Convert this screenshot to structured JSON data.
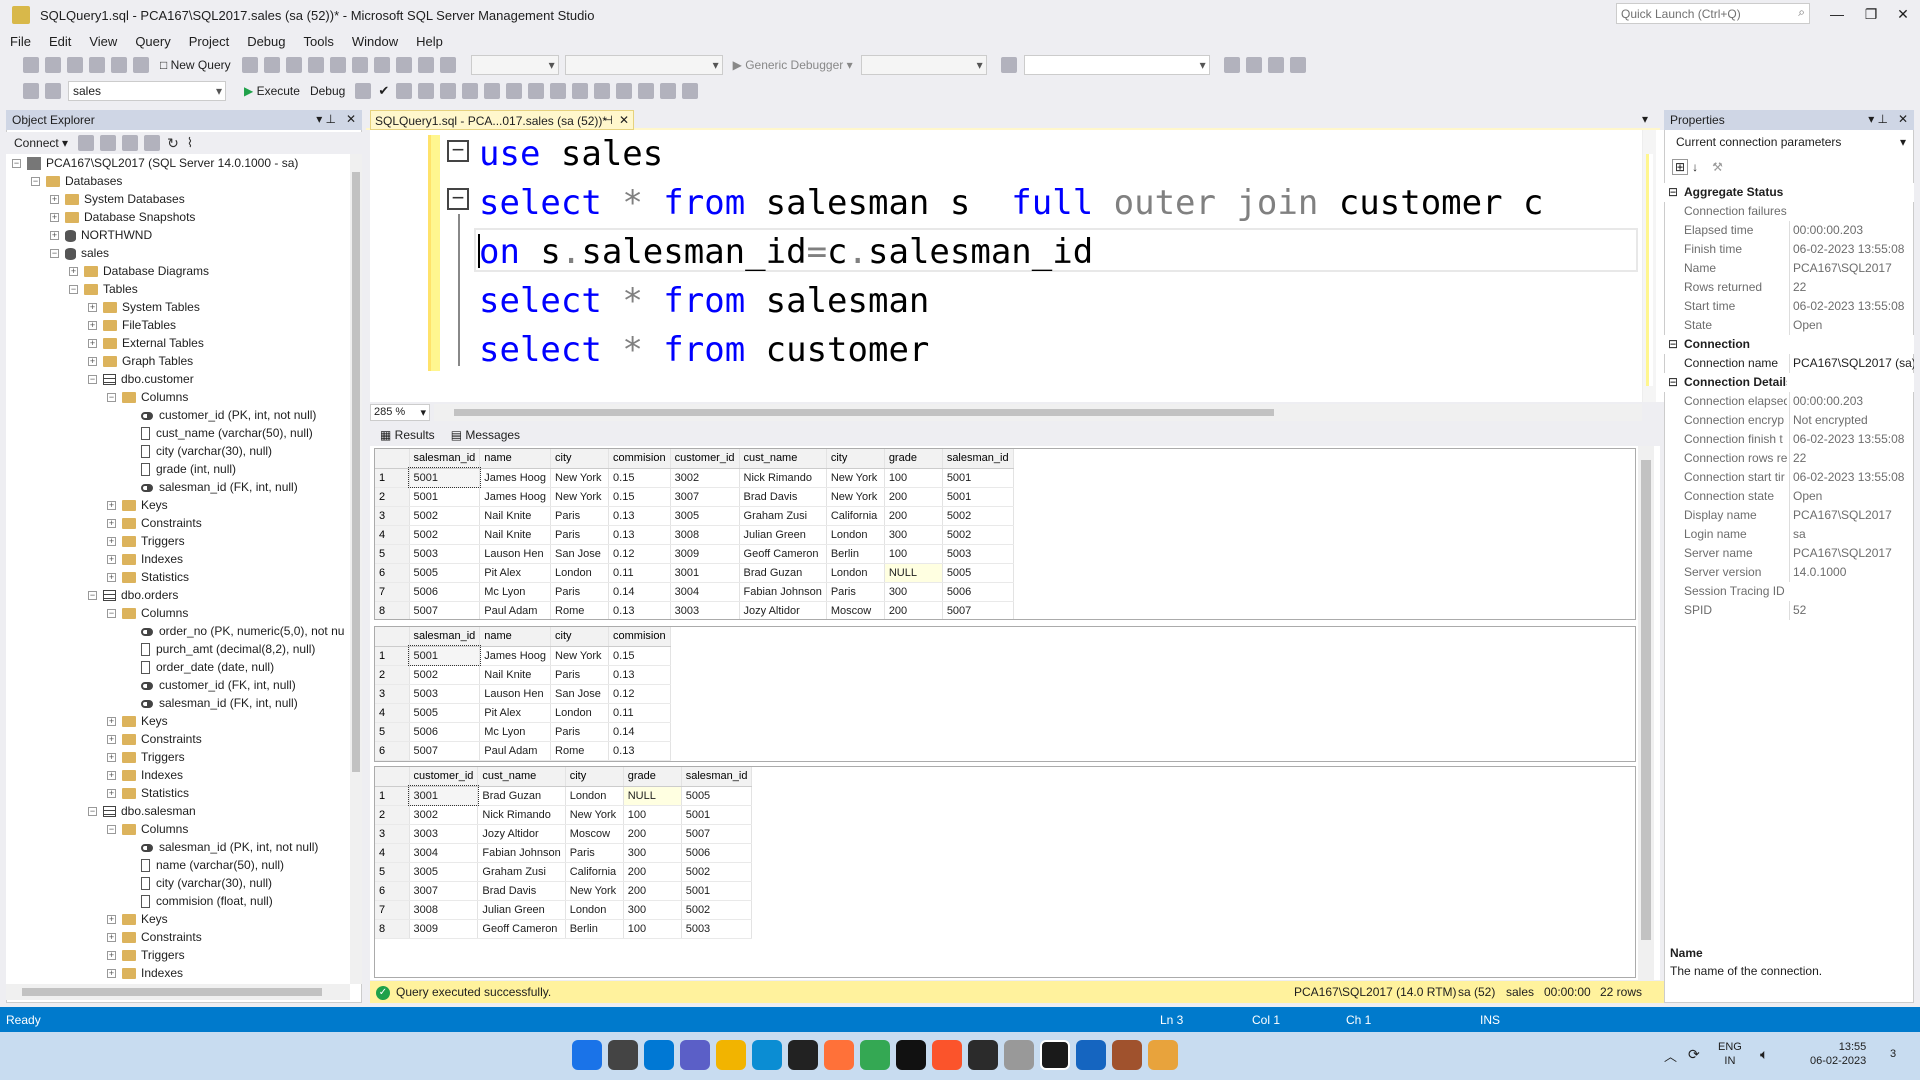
{
  "window": {
    "title": "SQLQuery1.sql - PCA167\\SQL2017.sales (sa (52))* - Microsoft SQL Server Management Studio",
    "quick_launch": "Quick Launch (Ctrl+Q)"
  },
  "menu": [
    "File",
    "Edit",
    "View",
    "Query",
    "Project",
    "Debug",
    "Tools",
    "Window",
    "Help"
  ],
  "toolbar": {
    "new_query": "New Query",
    "generic_debugger": "Generic Debugger",
    "database": "sales",
    "execute": "Execute",
    "debug": "Debug"
  },
  "object_explorer": {
    "title": "Object Explorer",
    "connect": "Connect",
    "tree": [
      {
        "label": "PCA167\\SQL2017 (SQL Server 14.0.1000 - sa)",
        "depth": 0,
        "icon": "server-icon",
        "toggle": "-"
      },
      {
        "label": "Databases",
        "depth": 1,
        "icon": "folder-icon",
        "toggle": "-"
      },
      {
        "label": "System Databases",
        "depth": 2,
        "icon": "folder-icon",
        "toggle": "+"
      },
      {
        "label": "Database Snapshots",
        "depth": 2,
        "icon": "folder-icon",
        "toggle": "+"
      },
      {
        "label": "NORTHWND",
        "depth": 2,
        "icon": "database-icon",
        "toggle": "+"
      },
      {
        "label": "sales",
        "depth": 2,
        "icon": "database-icon",
        "toggle": "-"
      },
      {
        "label": "Database Diagrams",
        "depth": 3,
        "icon": "folder-icon",
        "toggle": "+"
      },
      {
        "label": "Tables",
        "depth": 3,
        "icon": "folder-icon",
        "toggle": "-"
      },
      {
        "label": "System Tables",
        "depth": 4,
        "icon": "folder-icon",
        "toggle": "+"
      },
      {
        "label": "FileTables",
        "depth": 4,
        "icon": "folder-icon",
        "toggle": "+"
      },
      {
        "label": "External Tables",
        "depth": 4,
        "icon": "folder-icon",
        "toggle": "+"
      },
      {
        "label": "Graph Tables",
        "depth": 4,
        "icon": "folder-icon",
        "toggle": "+"
      },
      {
        "label": "dbo.customer",
        "depth": 4,
        "icon": "table-icon",
        "toggle": "-"
      },
      {
        "label": "Columns",
        "depth": 5,
        "icon": "folder-icon",
        "toggle": "-"
      },
      {
        "label": "customer_id (PK, int, not null)",
        "depth": 6,
        "icon": "key-icon",
        "toggle": ""
      },
      {
        "label": "cust_name (varchar(50), null)",
        "depth": 6,
        "icon": "column-icon",
        "toggle": ""
      },
      {
        "label": "city (varchar(30), null)",
        "depth": 6,
        "icon": "column-icon",
        "toggle": ""
      },
      {
        "label": "grade (int, null)",
        "depth": 6,
        "icon": "column-icon",
        "toggle": ""
      },
      {
        "label": "salesman_id (FK, int, null)",
        "depth": 6,
        "icon": "key-icon",
        "toggle": ""
      },
      {
        "label": "Keys",
        "depth": 5,
        "icon": "folder-icon",
        "toggle": "+"
      },
      {
        "label": "Constraints",
        "depth": 5,
        "icon": "folder-icon",
        "toggle": "+"
      },
      {
        "label": "Triggers",
        "depth": 5,
        "icon": "folder-icon",
        "toggle": "+"
      },
      {
        "label": "Indexes",
        "depth": 5,
        "icon": "folder-icon",
        "toggle": "+"
      },
      {
        "label": "Statistics",
        "depth": 5,
        "icon": "folder-icon",
        "toggle": "+"
      },
      {
        "label": "dbo.orders",
        "depth": 4,
        "icon": "table-icon",
        "toggle": "-"
      },
      {
        "label": "Columns",
        "depth": 5,
        "icon": "folder-icon",
        "toggle": "-"
      },
      {
        "label": "order_no (PK, numeric(5,0), not nu",
        "depth": 6,
        "icon": "key-icon",
        "toggle": ""
      },
      {
        "label": "purch_amt (decimal(8,2), null)",
        "depth": 6,
        "icon": "column-icon",
        "toggle": ""
      },
      {
        "label": "order_date (date, null)",
        "depth": 6,
        "icon": "column-icon",
        "toggle": ""
      },
      {
        "label": "customer_id (FK, int, null)",
        "depth": 6,
        "icon": "key-icon",
        "toggle": ""
      },
      {
        "label": "salesman_id (FK, int, null)",
        "depth": 6,
        "icon": "key-icon",
        "toggle": ""
      },
      {
        "label": "Keys",
        "depth": 5,
        "icon": "folder-icon",
        "toggle": "+"
      },
      {
        "label": "Constraints",
        "depth": 5,
        "icon": "folder-icon",
        "toggle": "+"
      },
      {
        "label": "Triggers",
        "depth": 5,
        "icon": "folder-icon",
        "toggle": "+"
      },
      {
        "label": "Indexes",
        "depth": 5,
        "icon": "folder-icon",
        "toggle": "+"
      },
      {
        "label": "Statistics",
        "depth": 5,
        "icon": "folder-icon",
        "toggle": "+"
      },
      {
        "label": "dbo.salesman",
        "depth": 4,
        "icon": "table-icon",
        "toggle": "-"
      },
      {
        "label": "Columns",
        "depth": 5,
        "icon": "folder-icon",
        "toggle": "-"
      },
      {
        "label": "salesman_id (PK, int, not null)",
        "depth": 6,
        "icon": "key-icon",
        "toggle": ""
      },
      {
        "label": "name (varchar(50), null)",
        "depth": 6,
        "icon": "column-icon",
        "toggle": ""
      },
      {
        "label": "city (varchar(30), null)",
        "depth": 6,
        "icon": "column-icon",
        "toggle": ""
      },
      {
        "label": "commision (float, null)",
        "depth": 6,
        "icon": "column-icon",
        "toggle": ""
      },
      {
        "label": "Keys",
        "depth": 5,
        "icon": "folder-icon",
        "toggle": "+"
      },
      {
        "label": "Constraints",
        "depth": 5,
        "icon": "folder-icon",
        "toggle": "+"
      },
      {
        "label": "Triggers",
        "depth": 5,
        "icon": "folder-icon",
        "toggle": "+"
      },
      {
        "label": "Indexes",
        "depth": 5,
        "icon": "folder-icon",
        "toggle": "+"
      }
    ]
  },
  "editor": {
    "tab": "SQLQuery1.sql - PCA...017.sales (sa (52))*",
    "zoom": "285 %",
    "lines": [
      [
        {
          "t": "use",
          "c": "kw"
        },
        {
          "t": " sales",
          "c": "plain"
        }
      ],
      [
        {
          "t": "select",
          "c": "kw"
        },
        {
          "t": " ",
          "c": "plain"
        },
        {
          "t": "*",
          "c": "gr"
        },
        {
          "t": " ",
          "c": "plain"
        },
        {
          "t": "from",
          "c": "kw"
        },
        {
          "t": " salesman s  ",
          "c": "plain"
        },
        {
          "t": "full",
          "c": "kw"
        },
        {
          "t": " outer join",
          "c": "gr"
        },
        {
          "t": " customer c",
          "c": "plain"
        }
      ],
      [
        {
          "t": "on",
          "c": "kw"
        },
        {
          "t": " s",
          "c": "plain"
        },
        {
          "t": ".",
          "c": "gr"
        },
        {
          "t": "salesman_id",
          "c": "plain"
        },
        {
          "t": "=",
          "c": "gr"
        },
        {
          "t": "c",
          "c": "plain"
        },
        {
          "t": ".",
          "c": "gr"
        },
        {
          "t": "salesman_id",
          "c": "plain"
        }
      ],
      [
        {
          "t": "select",
          "c": "kw"
        },
        {
          "t": " ",
          "c": "plain"
        },
        {
          "t": "*",
          "c": "gr"
        },
        {
          "t": " ",
          "c": "plain"
        },
        {
          "t": "from",
          "c": "kw"
        },
        {
          "t": " salesman",
          "c": "plain"
        }
      ],
      [
        {
          "t": "select",
          "c": "kw"
        },
        {
          "t": " ",
          "c": "plain"
        },
        {
          "t": "*",
          "c": "gr"
        },
        {
          "t": " ",
          "c": "plain"
        },
        {
          "t": "from",
          "c": "kw"
        },
        {
          "t": " customer",
          "c": "plain"
        }
      ]
    ]
  },
  "results": {
    "tab_results": "Results",
    "tab_messages": "Messages",
    "grids": [
      {
        "columns": [
          "salesman_id",
          "name",
          "city",
          "commision",
          "customer_id",
          "cust_name",
          "city",
          "grade",
          "salesman_id"
        ],
        "rows": [
          [
            "1",
            "5001",
            "James Hoog",
            "New York",
            "0.15",
            "3002",
            "Nick Rimando",
            "New York",
            "100",
            "5001"
          ],
          [
            "2",
            "5001",
            "James Hoog",
            "New York",
            "0.15",
            "3007",
            "Brad Davis",
            "New York",
            "200",
            "5001"
          ],
          [
            "3",
            "5002",
            "Nail Knite",
            "Paris",
            "0.13",
            "3005",
            "Graham Zusi",
            "California",
            "200",
            "5002"
          ],
          [
            "4",
            "5002",
            "Nail Knite",
            "Paris",
            "0.13",
            "3008",
            "Julian Green",
            "London",
            "300",
            "5002"
          ],
          [
            "5",
            "5003",
            "Lauson Hen",
            "San Jose",
            "0.12",
            "3009",
            "Geoff Cameron",
            "Berlin",
            "100",
            "5003"
          ],
          [
            "6",
            "5005",
            "Pit Alex",
            "London",
            "0.11",
            "3001",
            "Brad Guzan",
            "London",
            "NULL",
            "5005"
          ],
          [
            "7",
            "5006",
            "Mc Lyon",
            "Paris",
            "0.14",
            "3004",
            "Fabian Johnson",
            "Paris",
            "300",
            "5006"
          ],
          [
            "8",
            "5007",
            "Paul Adam",
            "Rome",
            "0.13",
            "3003",
            "Jozy Altidor",
            "Moscow",
            "200",
            "5007"
          ]
        ]
      },
      {
        "columns": [
          "salesman_id",
          "name",
          "city",
          "commision"
        ],
        "rows": [
          [
            "1",
            "5001",
            "James Hoog",
            "New York",
            "0.15"
          ],
          [
            "2",
            "5002",
            "Nail Knite",
            "Paris",
            "0.13"
          ],
          [
            "3",
            "5003",
            "Lauson Hen",
            "San Jose",
            "0.12"
          ],
          [
            "4",
            "5005",
            "Pit Alex",
            "London",
            "0.11"
          ],
          [
            "5",
            "5006",
            "Mc Lyon",
            "Paris",
            "0.14"
          ],
          [
            "6",
            "5007",
            "Paul Adam",
            "Rome",
            "0.13"
          ]
        ]
      },
      {
        "columns": [
          "customer_id",
          "cust_name",
          "city",
          "grade",
          "salesman_id"
        ],
        "rows": [
          [
            "1",
            "3001",
            "Brad Guzan",
            "London",
            "NULL",
            "5005"
          ],
          [
            "2",
            "3002",
            "Nick Rimando",
            "New York",
            "100",
            "5001"
          ],
          [
            "3",
            "3003",
            "Jozy Altidor",
            "Moscow",
            "200",
            "5007"
          ],
          [
            "4",
            "3004",
            "Fabian Johnson",
            "Paris",
            "300",
            "5006"
          ],
          [
            "5",
            "3005",
            "Graham Zusi",
            "California",
            "200",
            "5002"
          ],
          [
            "6",
            "3007",
            "Brad Davis",
            "New York",
            "200",
            "5001"
          ],
          [
            "7",
            "3008",
            "Julian Green",
            "London",
            "300",
            "5002"
          ],
          [
            "8",
            "3009",
            "Geoff Cameron",
            "Berlin",
            "100",
            "5003"
          ]
        ]
      }
    ]
  },
  "query_status": {
    "message": "Query executed successfully.",
    "server": "PCA167\\SQL2017 (14.0 RTM)",
    "user": "sa (52)",
    "database": "sales",
    "elapsed": "00:00:00",
    "rows": "22 rows"
  },
  "properties": {
    "title": "Properties",
    "selector": "Current connection parameters",
    "description_title": "Name",
    "description_text": "The name of the connection.",
    "rows": [
      {
        "cat": true,
        "key": "Aggregate Status",
        "val": ""
      },
      {
        "cat": false,
        "key": "Connection failures",
        "val": ""
      },
      {
        "cat": false,
        "key": "Elapsed time",
        "val": "00:00:00.203"
      },
      {
        "cat": false,
        "key": "Finish time",
        "val": "06-02-2023 13:55:08"
      },
      {
        "cat": false,
        "key": "Name",
        "val": "PCA167\\SQL2017"
      },
      {
        "cat": false,
        "key": "Rows returned",
        "val": "22"
      },
      {
        "cat": false,
        "key": "Start time",
        "val": "06-02-2023 13:55:08"
      },
      {
        "cat": false,
        "key": "State",
        "val": "Open"
      },
      {
        "cat": true,
        "key": "Connection",
        "val": ""
      },
      {
        "cat": false,
        "key": "Connection name",
        "val": "PCA167\\SQL2017 (sa)",
        "dark": true
      },
      {
        "cat": true,
        "key": "Connection Details",
        "val": ""
      },
      {
        "cat": false,
        "key": "Connection elapsed",
        "val": "00:00:00.203"
      },
      {
        "cat": false,
        "key": "Connection encryp",
        "val": "Not encrypted"
      },
      {
        "cat": false,
        "key": "Connection finish t",
        "val": "06-02-2023 13:55:08"
      },
      {
        "cat": false,
        "key": "Connection rows re",
        "val": "22"
      },
      {
        "cat": false,
        "key": "Connection start tir",
        "val": "06-02-2023 13:55:08"
      },
      {
        "cat": false,
        "key": "Connection state",
        "val": "Open"
      },
      {
        "cat": false,
        "key": "Display name",
        "val": "PCA167\\SQL2017"
      },
      {
        "cat": false,
        "key": "Login name",
        "val": "sa"
      },
      {
        "cat": false,
        "key": "Server name",
        "val": "PCA167\\SQL2017"
      },
      {
        "cat": false,
        "key": "Server version",
        "val": "14.0.1000"
      },
      {
        "cat": false,
        "key": "Session Tracing ID",
        "val": ""
      },
      {
        "cat": false,
        "key": "SPID",
        "val": "52"
      }
    ]
  },
  "statusbar": {
    "ready": "Ready",
    "ln": "Ln 3",
    "col": "Col 1",
    "ch": "Ch 1",
    "ins": "INS"
  },
  "taskbar": {
    "lang1": "ENG",
    "lang2": "IN",
    "time": "13:55",
    "date": "06-02-2023",
    "notif": "3",
    "colors": [
      "#1a73e8",
      "#444",
      "#0078d4",
      "#5b5fc7",
      "#f2b400",
      "#0b8dd3",
      "#222",
      "#ff7139",
      "#34a853",
      "#111",
      "#fb542b",
      "#2b2b2b",
      "#999",
      "#1a1a1a",
      "#1565c0",
      "#a0522d",
      "#e8a33c"
    ]
  }
}
